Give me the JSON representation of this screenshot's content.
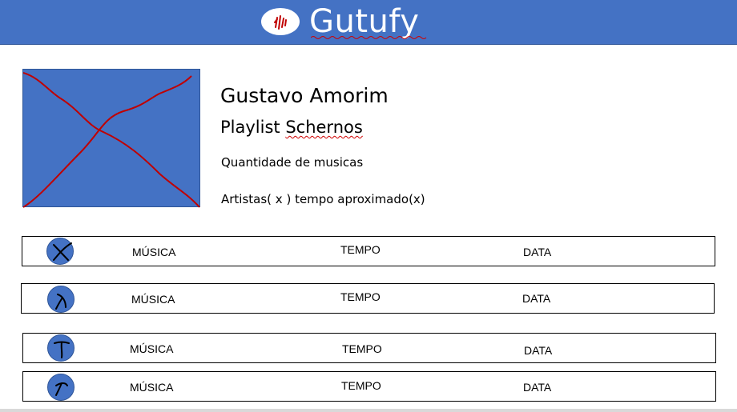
{
  "header": {
    "app_title": "Gutufy",
    "logo_icon": "hand-logo-icon",
    "background_color": "#4472c4"
  },
  "playlist": {
    "cover_icon": "crossed-out-image-placeholder",
    "owner": "Gustavo Amorim",
    "title_prefix": "Playlist ",
    "title_name": "Schernos",
    "song_count_label": "Quantidade de musicas",
    "artists_time_label": "Artistas( x ) tempo aproximado(x)"
  },
  "tracks": [
    {
      "icon": "play-scribble-icon",
      "music": "MÚSICA",
      "time": "TEMPO",
      "date": "DATA"
    },
    {
      "icon": "play-scribble-icon",
      "music": "MÚSICA",
      "time": "TEMPO",
      "date": "DATA"
    },
    {
      "icon": "play-scribble-icon",
      "music": "MÚSICA",
      "time": "TEMPO",
      "date": "DATA"
    },
    {
      "icon": "play-scribble-icon",
      "music": "MÚSICA",
      "time": "TEMPO",
      "date": "DATA"
    }
  ],
  "colors": {
    "accent": "#4472c4",
    "scribble": "#c00000"
  }
}
